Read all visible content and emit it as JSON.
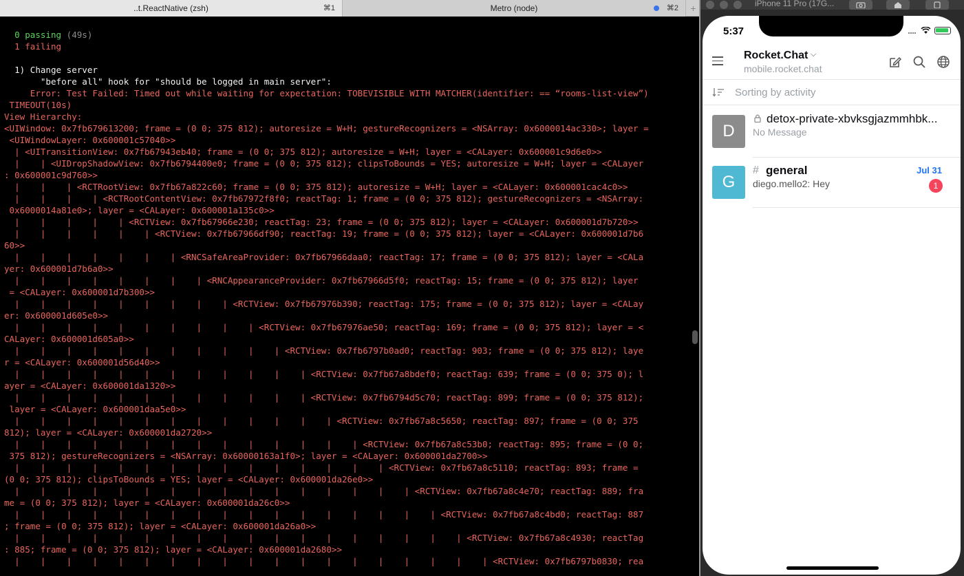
{
  "terminal": {
    "tabs": [
      {
        "title": "..t.ReactNative (zsh)",
        "shortcut": "⌘1"
      },
      {
        "title": "Metro (node)",
        "shortcut": "⌘2"
      }
    ],
    "add_tab": "+",
    "lines": [
      [
        {
          "t": "  0 passing",
          "c": "pass"
        },
        {
          "t": " (49s)",
          "c": "gray"
        }
      ],
      [
        {
          "t": "  1 failing",
          "c": "red"
        }
      ],
      [
        {
          "t": "",
          "c": "white"
        }
      ],
      [
        {
          "t": "  1) Change server",
          "c": "white"
        }
      ],
      [
        {
          "t": "       \"before all\" hook for \"should be logged in main server\":",
          "c": "white"
        }
      ],
      [
        {
          "t": "     Error: Test Failed: Timed out while waiting for expectation: TOBEVISIBLE WITH MATCHER(identifier: == “rooms-list-view”)",
          "c": "err"
        }
      ],
      [
        {
          "t": " TIMEOUT(10s)",
          "c": "err"
        }
      ],
      [
        {
          "t": "View Hierarchy:",
          "c": "err"
        }
      ],
      [
        {
          "t": "<UIWindow: 0x7fb679613200; frame = (0 0; 375 812); autoresize = W+H; gestureRecognizers = <NSArray: 0x6000014ac330>; layer =",
          "c": "err"
        }
      ],
      [
        {
          "t": " <UIWindowLayer: 0x600001c57040>>",
          "c": "err"
        }
      ],
      [
        {
          "t": "  | <UITransitionView: 0x7fb67943eb40; frame = (0 0; 375 812); autoresize = W+H; layer = <CALayer: 0x600001c9d6e0>>",
          "c": "err"
        }
      ],
      [
        {
          "t": "  |    | <UIDropShadowView: 0x7fb6794400e0; frame = (0 0; 375 812); clipsToBounds = YES; autoresize = W+H; layer = <CALayer",
          "c": "err"
        }
      ],
      [
        {
          "t": ": 0x600001c9d760>>",
          "c": "err"
        }
      ],
      [
        {
          "t": "  |    |    | <RCTRootView: 0x7fb67a822c60; frame = (0 0; 375 812); autoresize = W+H; layer = <CALayer: 0x600001cac4c0>>",
          "c": "err"
        }
      ],
      [
        {
          "t": "  |    |    |    | <RCTRootContentView: 0x7fb67972f8f0; reactTag: 1; frame = (0 0; 375 812); gestureRecognizers = <NSArray:",
          "c": "err"
        }
      ],
      [
        {
          "t": " 0x6000014a81e0>; layer = <CALayer: 0x600001a135c0>>",
          "c": "err"
        }
      ],
      [
        {
          "t": "  |    |    |    |    | <RCTView: 0x7fb67966e230; reactTag: 23; frame = (0 0; 375 812); layer = <CALayer: 0x600001d7b720>>",
          "c": "err"
        }
      ],
      [
        {
          "t": "  |    |    |    |    |    | <RCTView: 0x7fb67966df90; reactTag: 19; frame = (0 0; 375 812); layer = <CALayer: 0x600001d7b6",
          "c": "err"
        }
      ],
      [
        {
          "t": "60>>",
          "c": "err"
        }
      ],
      [
        {
          "t": "  |    |    |    |    |    |    | <RNCSafeAreaProvider: 0x7fb67966daa0; reactTag: 17; frame = (0 0; 375 812); layer = <CALa",
          "c": "err"
        }
      ],
      [
        {
          "t": "yer: 0x600001d7b6a0>>",
          "c": "err"
        }
      ],
      [
        {
          "t": "  |    |    |    |    |    |    |    | <RNCAppearanceProvider: 0x7fb67966d5f0; reactTag: 15; frame = (0 0; 375 812); layer",
          "c": "err"
        }
      ],
      [
        {
          "t": " = <CALayer: 0x600001d7b300>>",
          "c": "err"
        }
      ],
      [
        {
          "t": "  |    |    |    |    |    |    |    |    | <RCTView: 0x7fb67976b390; reactTag: 175; frame = (0 0; 375 812); layer = <CALay",
          "c": "err"
        }
      ],
      [
        {
          "t": "er: 0x600001d605e0>>",
          "c": "err"
        }
      ],
      [
        {
          "t": "  |    |    |    |    |    |    |    |    |    | <RCTView: 0x7fb67976ae50; reactTag: 169; frame = (0 0; 375 812); layer = <",
          "c": "err"
        }
      ],
      [
        {
          "t": "CALayer: 0x600001d605a0>>",
          "c": "err"
        }
      ],
      [
        {
          "t": "  |    |    |    |    |    |    |    |    |    |    | <RCTView: 0x7fb6797b0ad0; reactTag: 903; frame = (0 0; 375 812); laye",
          "c": "err"
        }
      ],
      [
        {
          "t": "r = <CALayer: 0x600001d56d40>>",
          "c": "err"
        }
      ],
      [
        {
          "t": "  |    |    |    |    |    |    |    |    |    |    |    | <RCTView: 0x7fb67a8bdef0; reactTag: 639; frame = (0 0; 375 0); l",
          "c": "err"
        }
      ],
      [
        {
          "t": "ayer = <CALayer: 0x600001da1320>>",
          "c": "err"
        }
      ],
      [
        {
          "t": "  |    |    |    |    |    |    |    |    |    |    |    | <RCTView: 0x7fb6794d5c70; reactTag: 899; frame = (0 0; 375 812);",
          "c": "err"
        }
      ],
      [
        {
          "t": " layer = <CALayer: 0x600001daa5e0>>",
          "c": "err"
        }
      ],
      [
        {
          "t": "  |    |    |    |    |    |    |    |    |    |    |    |    | <RCTView: 0x7fb67a8c5650; reactTag: 897; frame = (0 0; 375",
          "c": "err"
        }
      ],
      [
        {
          "t": "812); layer = <CALayer: 0x600001da2720>>",
          "c": "err"
        }
      ],
      [
        {
          "t": "  |    |    |    |    |    |    |    |    |    |    |    |    |    | <RCTView: 0x7fb67a8c53b0; reactTag: 895; frame = (0 0;",
          "c": "err"
        }
      ],
      [
        {
          "t": " 375 812); gestureRecognizers = <NSArray: 0x60000163a1f0>; layer = <CALayer: 0x600001da2700>>",
          "c": "err"
        }
      ],
      [
        {
          "t": "  |    |    |    |    |    |    |    |    |    |    |    |    |    |    | <RCTView: 0x7fb67a8c5110; reactTag: 893; frame =",
          "c": "err"
        }
      ],
      [
        {
          "t": "(0 0; 375 812); clipsToBounds = YES; layer = <CALayer: 0x600001da26e0>>",
          "c": "err"
        }
      ],
      [
        {
          "t": "  |    |    |    |    |    |    |    |    |    |    |    |    |    |    |    | <RCTView: 0x7fb67a8c4e70; reactTag: 889; fra",
          "c": "err"
        }
      ],
      [
        {
          "t": "me = (0 0; 375 812); layer = <CALayer: 0x600001da26c0>>",
          "c": "err"
        }
      ],
      [
        {
          "t": "  |    |    |    |    |    |    |    |    |    |    |    |    |    |    |    |    | <RCTView: 0x7fb67a8c4bd0; reactTag: 887",
          "c": "err"
        }
      ],
      [
        {
          "t": "; frame = (0 0; 375 812); layer = <CALayer: 0x600001da26a0>>",
          "c": "err"
        }
      ],
      [
        {
          "t": "  |    |    |    |    |    |    |    |    |    |    |    |    |    |    |    |    |    | <RCTView: 0x7fb67a8c4930; reactTag",
          "c": "err"
        }
      ],
      [
        {
          "t": ": 885; frame = (0 0; 375 812); layer = <CALayer: 0x600001da2680>>",
          "c": "err"
        }
      ],
      [
        {
          "t": "  |    |    |    |    |    |    |    |    |    |    |    |    |    |    |    |    |    |    | <RCTView: 0x7fb6797b0830; rea",
          "c": "err"
        }
      ]
    ]
  },
  "simulator": {
    "title": "iPhone 11 Pro (17G...",
    "status_time": "5:37",
    "server": {
      "name": "Rocket.Chat",
      "url": "mobile.rocket.chat"
    },
    "sort_label": "Sorting by activity",
    "rooms": [
      {
        "avatar_letter": "D",
        "name": "detox-private-xbvksgjazmmhbk...",
        "message": "No Message",
        "avatar_color": "#8c8c8c"
      },
      {
        "avatar_letter": "G",
        "name": "general",
        "message": "diego.mello2: Hey",
        "date": "Jul 31",
        "unread": "1",
        "avatar_color": "#4fb9d3"
      }
    ],
    "icons": [
      "menu-icon",
      "compose-icon",
      "search-icon",
      "globe-icon",
      "sort-icon",
      "lock-icon",
      "hash-icon",
      "wifi-icon",
      "battery-icon"
    ]
  }
}
